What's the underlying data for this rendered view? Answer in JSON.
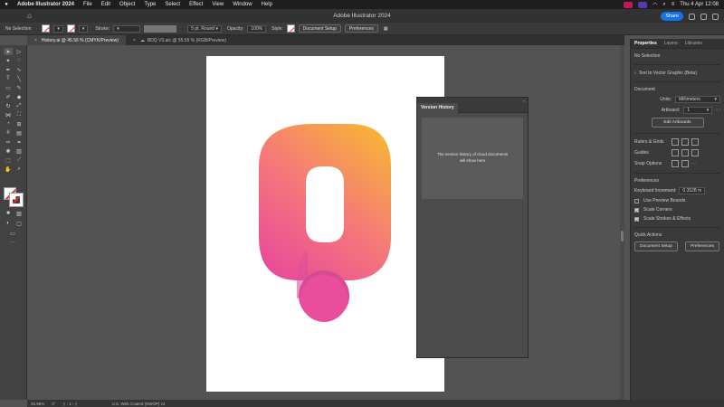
{
  "menubar": {
    "app_name": "Adobe Illustrator 2024",
    "items": [
      "File",
      "Edit",
      "Object",
      "Type",
      "Select",
      "Effect",
      "View",
      "Window",
      "Help"
    ],
    "datetime": "Thu 4 Apr  12:08"
  },
  "titlebar": {
    "title": "Adobe Illustrator 2024",
    "share_label": "Share"
  },
  "controlbar": {
    "selection": "No Selection",
    "stroke_label": "Stroke:",
    "brush": "5 pt. Round",
    "opacity_label": "Opacity:",
    "opacity_value": "100%",
    "style_label": "Style:",
    "document_setup": "Document Setup",
    "preferences": "Preferences"
  },
  "tabs": [
    {
      "label": "History.ai @ 45.56 % (CMYK/Preview)",
      "active": true
    },
    {
      "label": "BDQ V3.aic @ 55.55 % (RGB/Preview)",
      "active": false
    }
  ],
  "version_history": {
    "title": "Version History",
    "message": "The version history of cloud documents will show here"
  },
  "properties": {
    "tabs": [
      "Properties",
      "Layers",
      "Libraries"
    ],
    "no_selection": "No Selection",
    "text_to_vector": "Text to Vector Graphic (Beta)",
    "document_label": "Document",
    "units_label": "Units:",
    "units_value": "Millimeters",
    "artboard_label": "Artboard:",
    "artboard_value": "1",
    "edit_artboards": "Edit Artboards",
    "rulers_grids": "Rulers & Grids",
    "guides": "Guides",
    "snap_options": "Snap Options",
    "preferences_label": "Preferences",
    "keyboard_increment_label": "Keyboard Increment:",
    "keyboard_increment_value": "0.3528 m",
    "use_preview_bounds": "Use Preview Bounds",
    "scale_corners": "Scale Corners",
    "scale_strokes": "Scale Strokes & Effects",
    "quick_actions": "Quick Actions",
    "document_setup_btn": "Document Setup",
    "preferences_btn": "Preferences"
  },
  "statusbar": {
    "zoom": "45.96%",
    "rotation": "0°",
    "artboard": "1",
    "profile": "U.S. Web Coated (SWOP) v2"
  },
  "colors": {
    "gradient_top": "#f7a93c",
    "gradient_mid": "#f46a8a",
    "gradient_bottom": "#e8449e",
    "accent": "#1473e6"
  }
}
